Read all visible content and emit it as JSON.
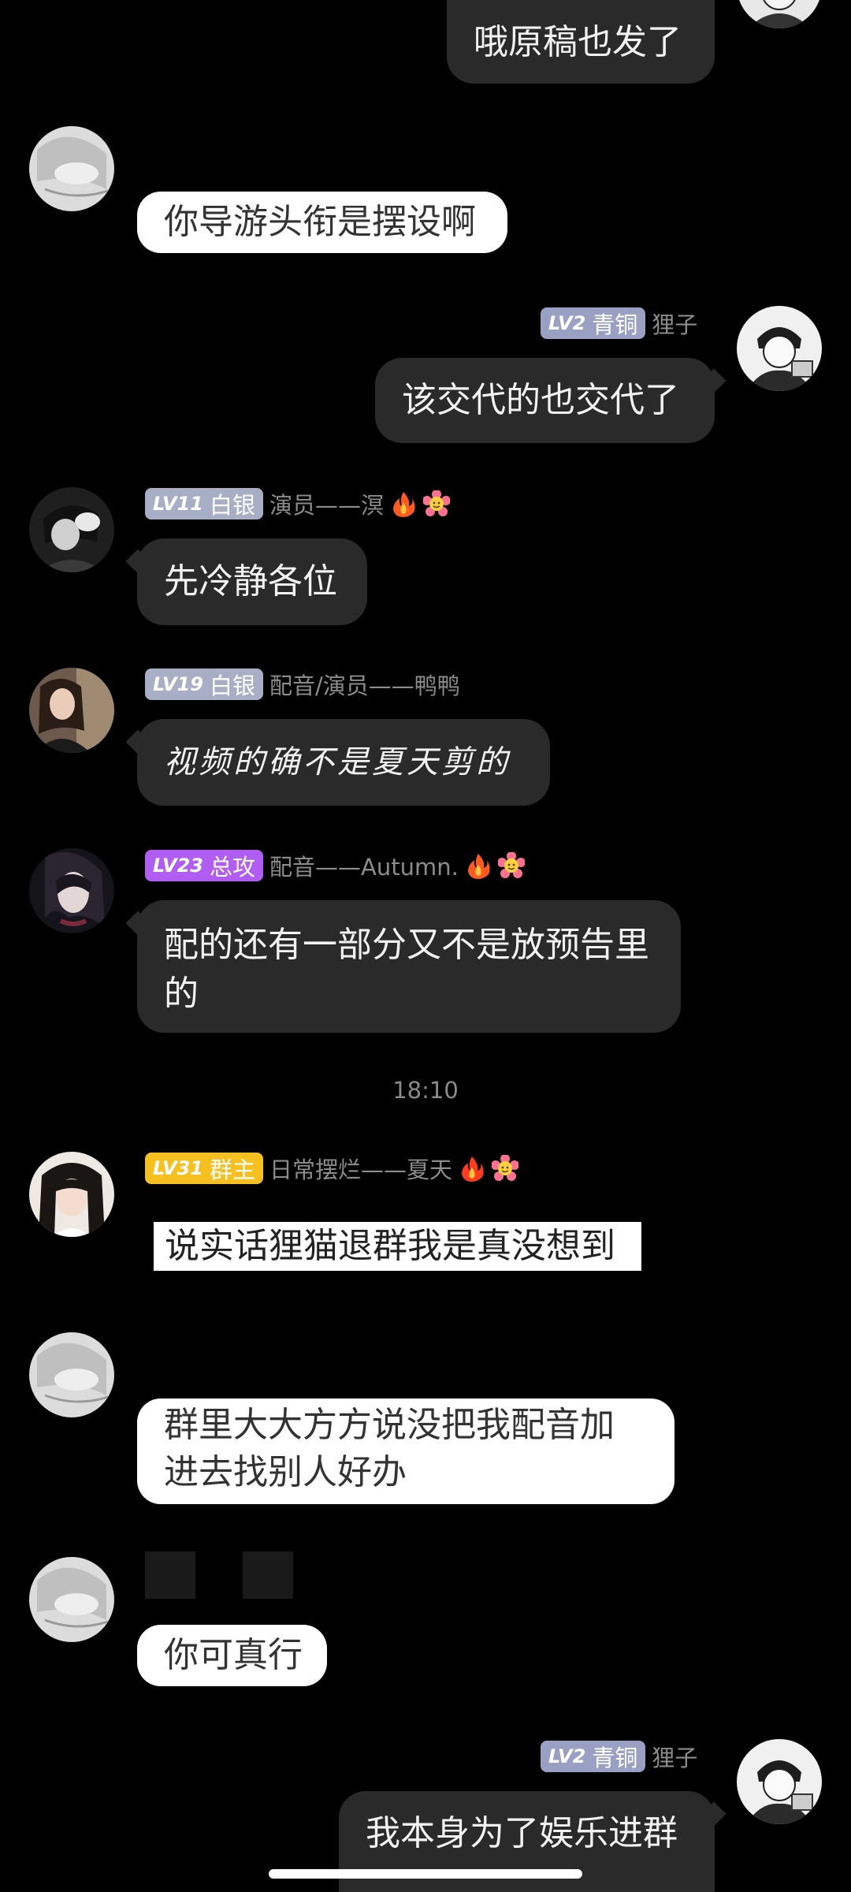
{
  "messages": [
    {
      "text": "哦原稿也发了"
    },
    {
      "text": "你导游头衔是摆设啊"
    },
    {
      "level": "LV2",
      "title": "青铜",
      "nickname": "狸子",
      "text": "该交代的也交代了"
    },
    {
      "level": "LV11",
      "title": "白银",
      "nickname": "演员——溟",
      "text": "先冷静各位"
    },
    {
      "level": "LV19",
      "title": "白银",
      "nickname": "配音/演员——鸭鸭",
      "text": "视频的确不是夏天剪的"
    },
    {
      "level": "LV23",
      "title": "总攻",
      "nickname": "配音——Autumn.",
      "text": "配的还有一部分又不是放预告里的"
    },
    {
      "level": "LV31",
      "title": "群主",
      "nickname": "日常摆烂——夏天",
      "text": "说实话狸猫退群我是真没想到"
    },
    {
      "text": "群里大大方方说没把我配音加进去找别人好办"
    },
    {
      "text": "你可真行"
    },
    {
      "level": "LV2",
      "title": "青铜",
      "nickname": "狸子",
      "text": "我本身为了娱乐进群"
    }
  ],
  "timestamp": "18:10",
  "icons": [
    "fire-icon",
    "flower-face-icon"
  ],
  "colors": {
    "background": "#000000",
    "bubble_dark": "#2a2a2a",
    "bubble_light": "#ffffff",
    "badge_bronze": "#9aa0c3",
    "badge_silver": "#a9aec7",
    "badge_purple": "#b15cf2",
    "badge_gold": "#f5c020"
  }
}
